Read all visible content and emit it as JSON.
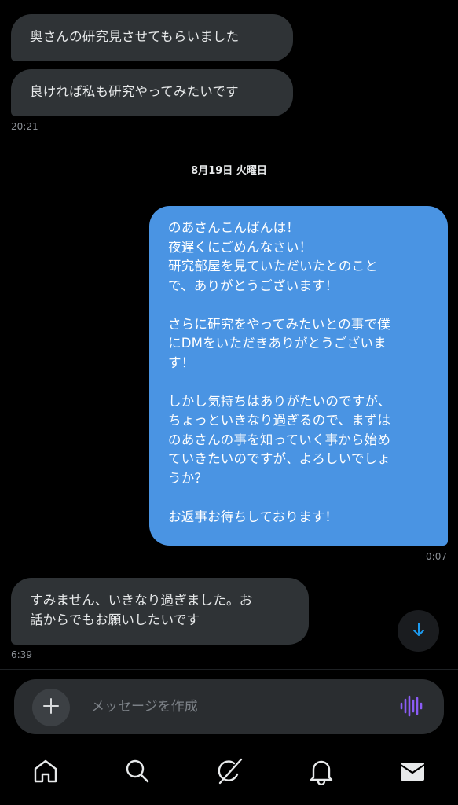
{
  "messages": [
    {
      "direction": "in",
      "text": "奥さんの研究見させてもらいました"
    },
    {
      "direction": "in",
      "text": "良ければ私も研究やってみたいです",
      "time": "20:21"
    },
    {
      "direction": "out",
      "text": "のあさんこんばんは！\n夜遅くにごめんなさい！\n研究部屋を見ていただいたとのこと\nで、ありがとうございます！\n\nさらに研究をやってみたいとの事で僕\nにDMをいただきありがとうございま\nす！\n\nしかし気持ちはありがたいのですが、\nちょっといきなり過ぎるので、まずは\nのあさんの事を知っていく事から始め\nていきたいのですが、よろしいでしょ\nうか？\n\nお返事お待ちしております！",
      "time": "0:07"
    },
    {
      "direction": "in",
      "text": "すみません、いきなり過ぎました。お\n話からでもお願いしたいです",
      "time": "6:39"
    }
  ],
  "date_separator": "8月19日 火曜日",
  "composer": {
    "placeholder": "メッセージを作成",
    "value": ""
  },
  "icons": {
    "scroll_down": "arrow-down-icon",
    "add": "plus-icon",
    "voice": "voice-waveform-icon",
    "tabs": [
      "home-icon",
      "search-icon",
      "grok-icon",
      "bell-icon",
      "mail-icon"
    ]
  },
  "colors": {
    "background": "#000000",
    "incoming_bubble": "#2f3336",
    "outgoing_bubble": "#4a94e3",
    "accent_blue": "#1d9bf0",
    "voice_purple": "#8b5cf6",
    "timestamp": "#8b9096"
  }
}
